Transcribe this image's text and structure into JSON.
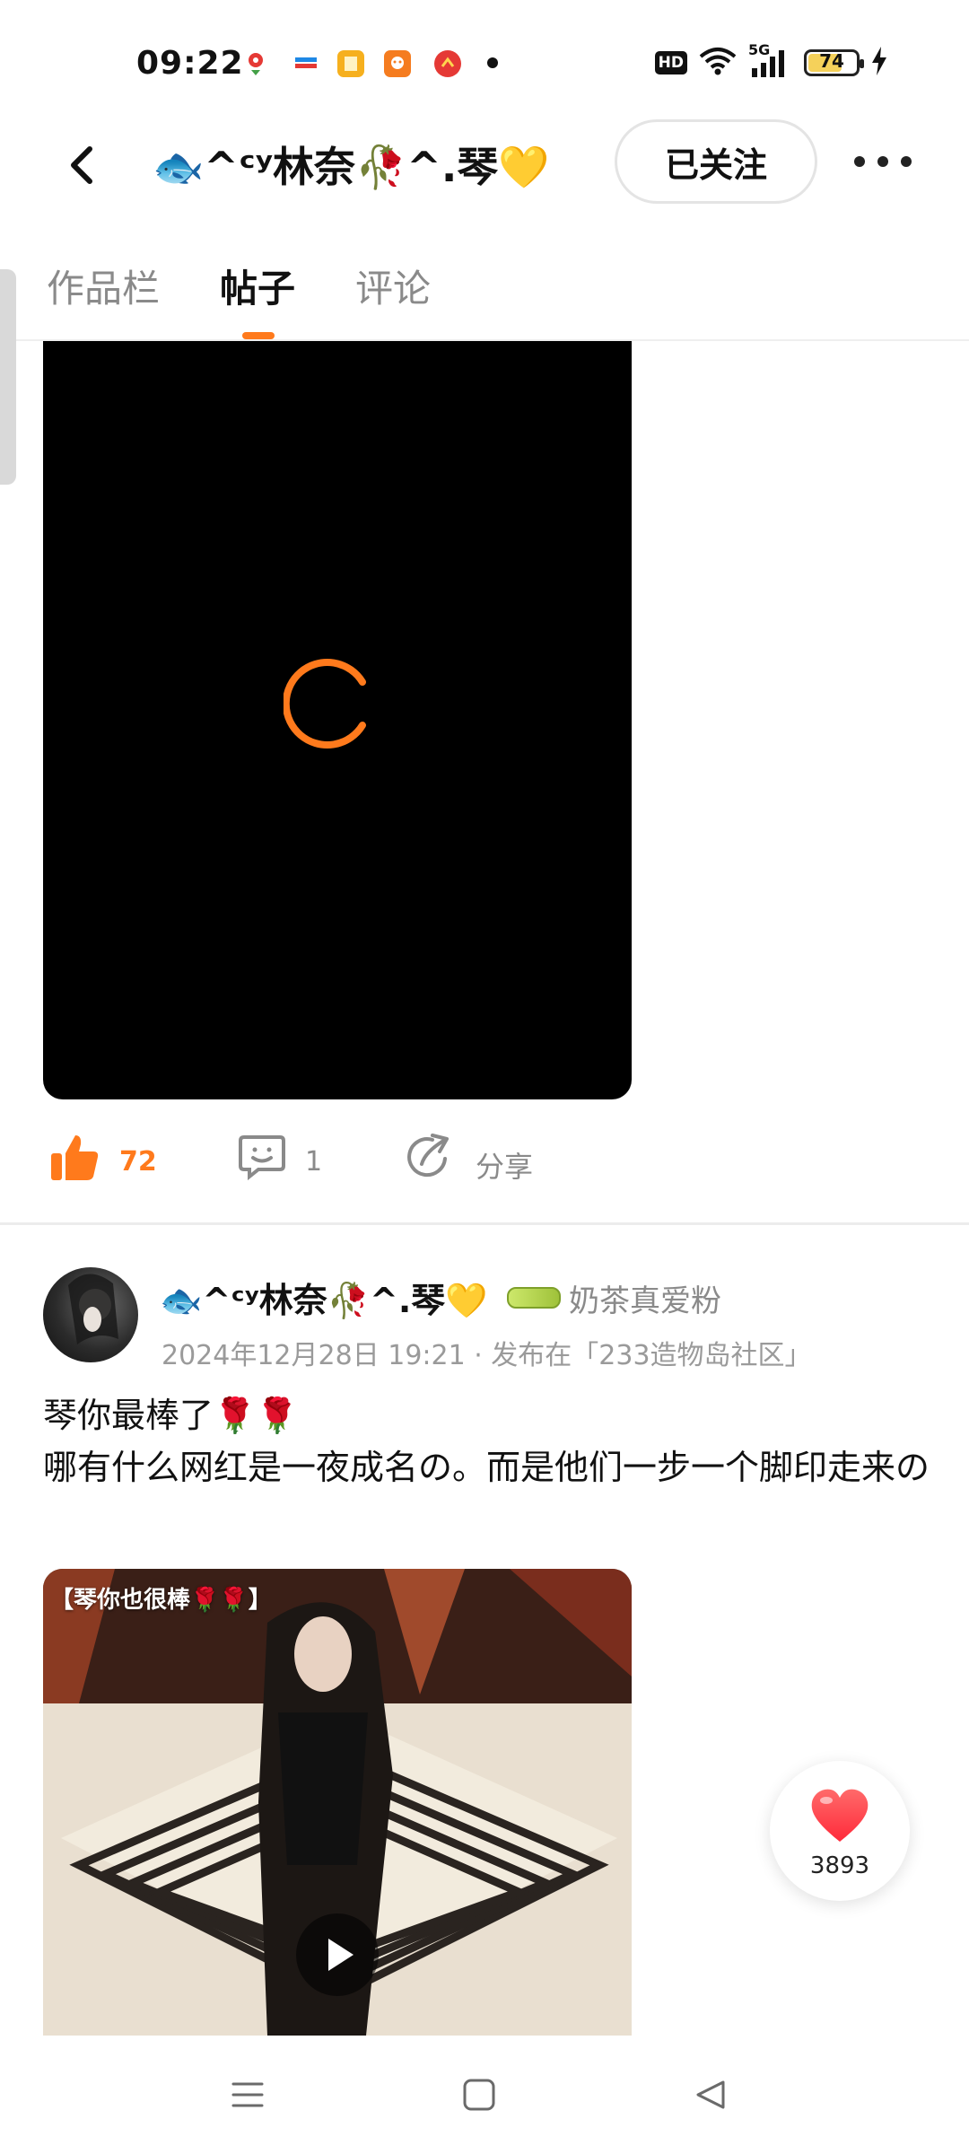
{
  "status_bar": {
    "time": "09:22",
    "network": "5G",
    "hd": "HD",
    "battery": "74",
    "battery_level": 0.74,
    "notification_icons": [
      "location-pin-icon",
      "wallet-icon",
      "book-app-icon",
      "bilibili-app-icon",
      "news-app-icon"
    ]
  },
  "header": {
    "title": "🐟^ᶜʸ林奈🥀^.琴💛",
    "follow_label": "已关注"
  },
  "tabs": [
    {
      "label": "作品栏",
      "active": false
    },
    {
      "label": "帖子",
      "active": true
    },
    {
      "label": "评论",
      "active": false
    }
  ],
  "post1": {
    "likes": "72",
    "comments": "1",
    "share_label": "分享"
  },
  "post2": {
    "author": "🐟^ᶜʸ林奈🥀^.琴💛",
    "badge_label": "奶茶真爱粉",
    "meta": "2024年12月28日  19:21 · 发布在「233造物岛社区」",
    "text": "琴你最棒了🌹🌹\n哪有什么网红是一夜成名の。而是他们一步一个脚印走来の",
    "video_caption": "【琴你也很棒🌹🌹】"
  },
  "floating_like": {
    "count": "3893"
  },
  "colors": {
    "accent": "#ff7a1c",
    "muted": "#8a8a8a",
    "heart": "#ff3b47"
  }
}
